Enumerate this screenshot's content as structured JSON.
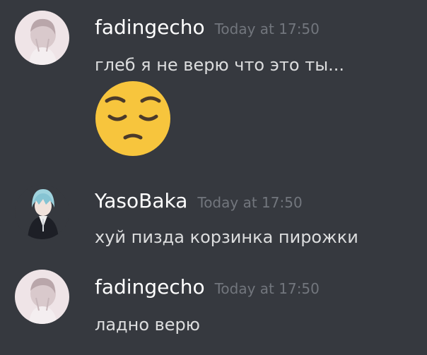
{
  "messages": [
    {
      "author": "fadingecho",
      "timestamp": "Today at 17:50",
      "text": "глеб я не верю что это ты...",
      "emoji": "pensive-face-emoji"
    },
    {
      "author": "YasoBaka",
      "timestamp": "Today at 17:50",
      "text": "хуй пизда корзинка пирожки"
    },
    {
      "author": "fadingecho",
      "timestamp": "Today at 17:50",
      "text": "ладно верю"
    }
  ],
  "colors": {
    "background": "#36393f",
    "username": "#ffffff",
    "timestamp": "#72767d",
    "message_text": "#dcddde",
    "emoji_face": "#f7c53d"
  }
}
